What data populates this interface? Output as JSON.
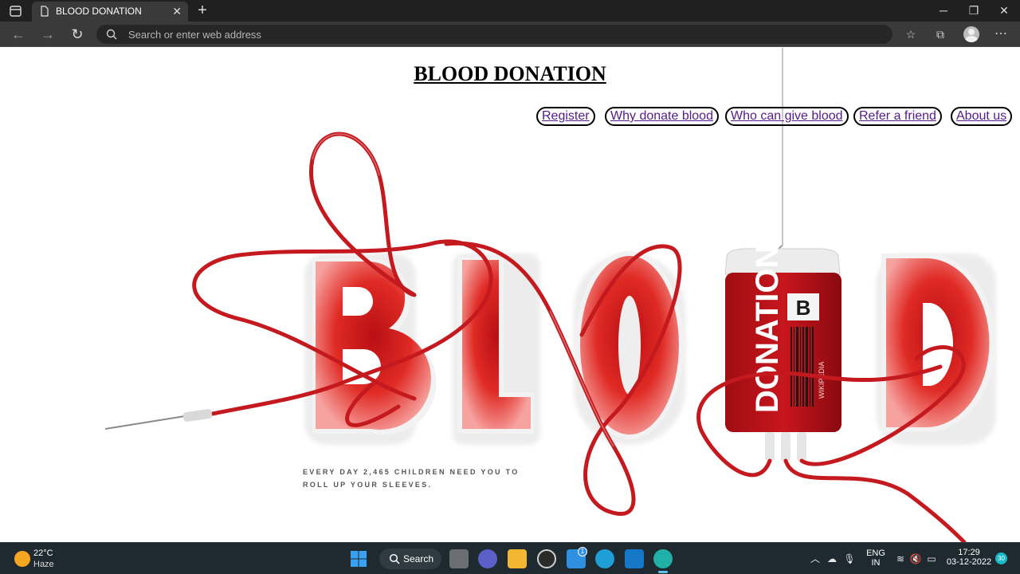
{
  "browser": {
    "tab_title": "BLOOD DONATION",
    "address_placeholder": "Search or enter web address"
  },
  "page": {
    "title": "BLOOD DONATION",
    "nav": [
      "Register",
      "Why donate blood",
      "Who can give blood",
      "Refer a friend",
      "About us"
    ],
    "hero": {
      "letters": [
        "B",
        "L",
        "O",
        "O",
        "D"
      ],
      "bag_text": "DONATION",
      "bag_badge": "B",
      "bag_side_text": "WIKIPEDIA",
      "tagline_line1": "EVERY DAY 2,465 CHILDREN NEED YOU TO",
      "tagline_line2": "ROLL UP YOUR SLEEVES."
    },
    "accent_color": "#c8161d"
  },
  "taskbar": {
    "weather_temp": "22°C",
    "weather_condition": "Haze",
    "search_label": "Search",
    "mail_badge": "1",
    "lang_line1": "ENG",
    "lang_line2": "IN",
    "time": "17:29",
    "date": "03-12-2022",
    "notification_count": "30"
  }
}
